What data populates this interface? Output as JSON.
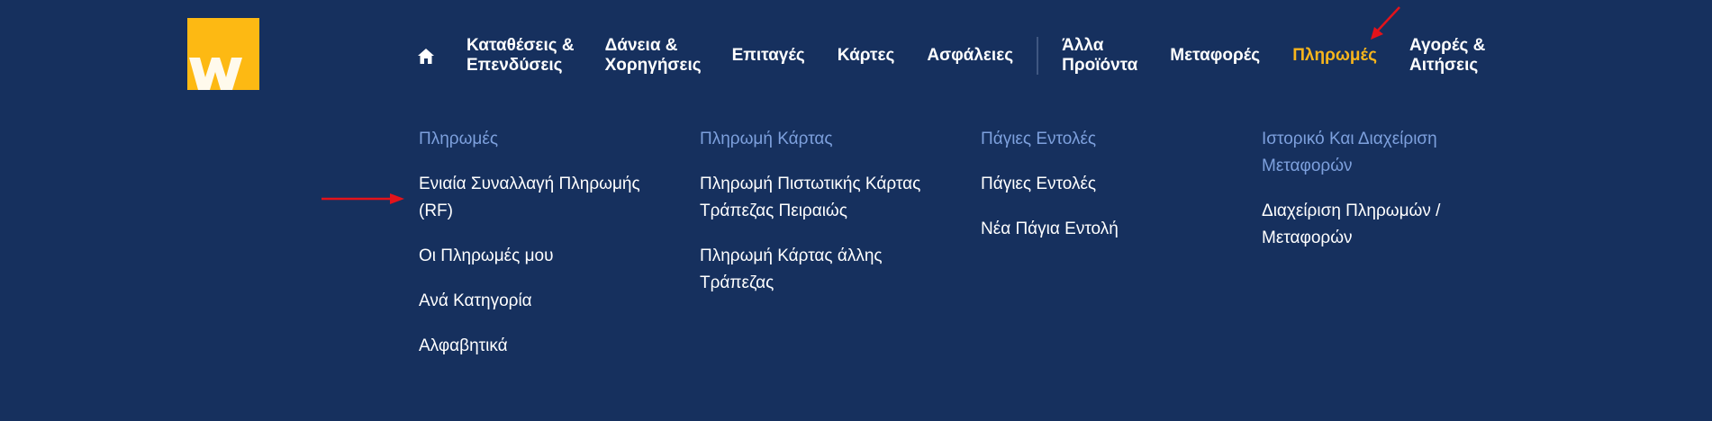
{
  "logo": {
    "letter": "w"
  },
  "nav": {
    "items": [
      {
        "label_l1": "Καταθέσεις &",
        "label_l2": "Επενδύσεις"
      },
      {
        "label_l1": "Δάνεια &",
        "label_l2": "Χορηγήσεις"
      },
      {
        "label": "Επιταγές"
      },
      {
        "label": "Κάρτες"
      },
      {
        "label": "Ασφάλειες"
      },
      {
        "label_l1": "Άλλα",
        "label_l2": "Προϊόντα"
      },
      {
        "label": "Μεταφορές"
      },
      {
        "label": "Πληρωμές"
      },
      {
        "label_l1": "Αγορές &",
        "label_l2": "Αιτήσεις"
      }
    ],
    "active_color": "#f7b51c"
  },
  "menu": {
    "columns": [
      {
        "heading": "Πληρωμές",
        "links": [
          {
            "l1": "Ενιαία Συναλλαγή Πληρωμής",
            "l2": "(RF)"
          },
          {
            "l1": "Οι Πληρωμές μου"
          },
          {
            "l1": "Ανά Κατηγορία"
          },
          {
            "l1": "Αλφαβητικά"
          }
        ]
      },
      {
        "heading": "Πληρωμή Κάρτας",
        "links": [
          {
            "l1": "Πληρωμή Πιστωτικής Κάρτας",
            "l2": "Τράπεζας Πειραιώς"
          },
          {
            "l1": "Πληρωμή Κάρτας άλλης",
            "l2": "Τράπεζας"
          }
        ]
      },
      {
        "heading": "Πάγιες Εντολές",
        "links": [
          {
            "l1": "Πάγιες Εντολές"
          },
          {
            "l1": "Νέα Πάγια Εντολή"
          }
        ]
      },
      {
        "heading_l1": "Ιστορικό Και Διαχείριση",
        "heading_l2": "Μεταφορών",
        "links": [
          {
            "l1": "Διαχείριση Πληρωμών /",
            "l2": "Μεταφορών"
          }
        ]
      }
    ]
  },
  "colors": {
    "background": "#16305e",
    "heading": "#7da0dd",
    "annotation_arrow": "#e3131b",
    "logo": "#fdb913"
  }
}
